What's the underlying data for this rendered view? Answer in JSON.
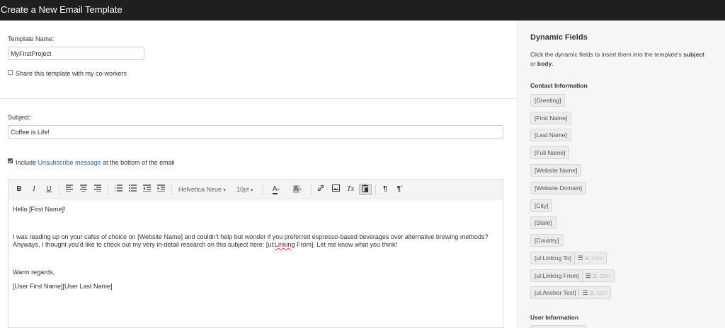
{
  "header": {
    "title": "Create a New Email Template"
  },
  "form": {
    "template_name_label": "Template Name:",
    "template_name_value": "MyFirstProject",
    "share_label": "Share this template with my co-workers",
    "share_checked": false,
    "subject_label": "Subject:",
    "subject_value": "Coffee is Life!",
    "include_prefix": "Include ",
    "include_link": "Unsubscribe message",
    "include_suffix": " at the bottom of the email",
    "include_checked": true
  },
  "toolbar": {
    "bold": "B",
    "italic": "I",
    "underline": "U",
    "font_family": "Helvetica Neue",
    "font_size": "10pt",
    "text_color": "A",
    "bg_color": "A",
    "clear_format": "Tx",
    "ltr": "¶",
    "rtl": "¶ʿ"
  },
  "editor": {
    "line1": "Hello [First Name]!",
    "line2": "I was reading up on your cafes of choice on [Website Name] and couldn't help but wonder if you preferred espresso-based beverages over alternative brewing methods?",
    "line3_pre": "Anyways, I thought you'd like to check out my very in-detail research on this subject here: [ul:",
    "line3_err": "Linking",
    "line3_post": " From]. Let me know what you think!",
    "line4": "Warm regards,",
    "line5": "[User First Name][User Last Name]"
  },
  "sidebar": {
    "title": "Dynamic Fields",
    "desc_pre": "Click the dynamic fields to insert them into the template's ",
    "desc_subject": "subject",
    "desc_or": "or ",
    "desc_body": "body",
    "desc_end": ".",
    "contact_heading": "Contact Information",
    "fields": [
      "[Greeting]",
      "[First Name]",
      "[Last Name]",
      "[Full Name]",
      "[Website Name]",
      "[Website Domain]",
      "[City]",
      "[State]",
      "[Country]"
    ],
    "link_fields": [
      "[ul:Linking To]",
      "[ul:Linking From]",
      "[ul:Anchor Text]"
    ],
    "csv_label": "CSV",
    "user_heading": "User Information"
  }
}
